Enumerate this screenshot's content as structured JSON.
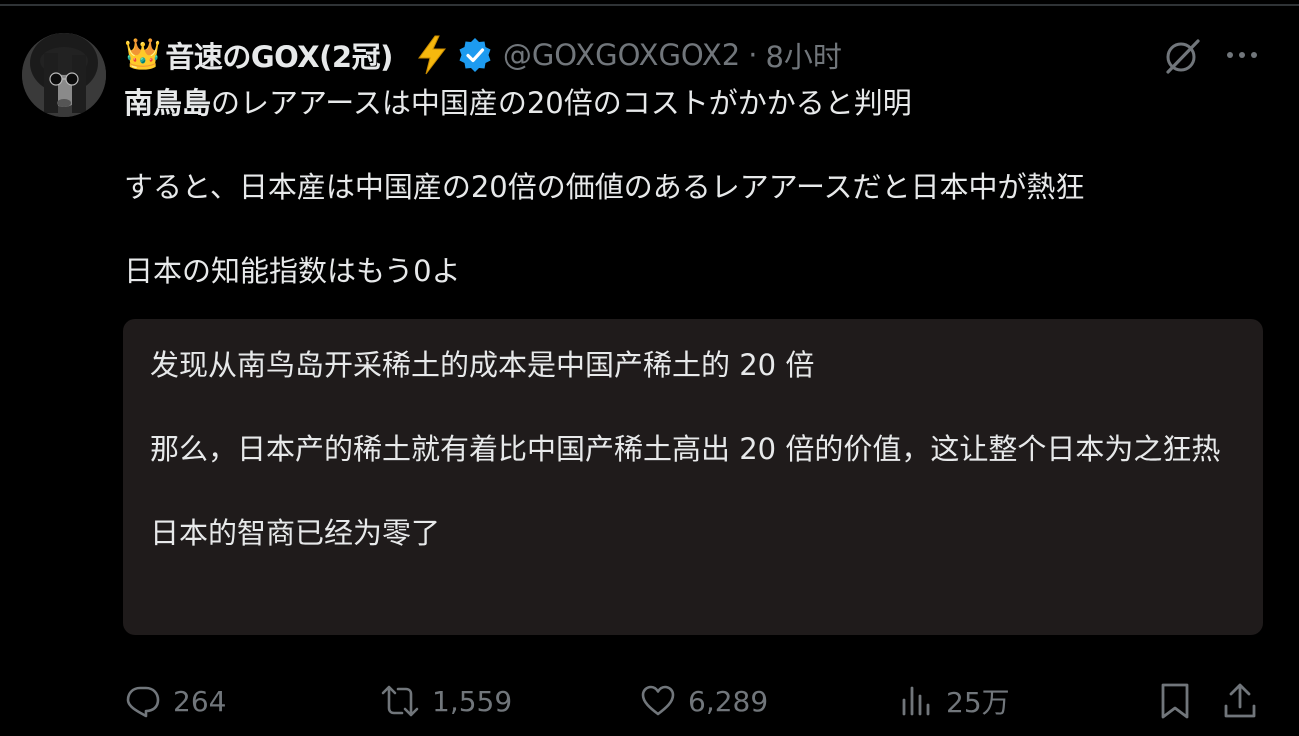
{
  "tweet": {
    "author": {
      "crown_emoji": "👑",
      "display_name": "音速のGOX(2冠)",
      "badge_emoji": "⚡",
      "handle": "@GOXGOXGOX2",
      "separator": "·",
      "time": "8小时"
    },
    "body": {
      "line1_bold": "南鳥島",
      "line1_rest": "のレアアースは中国産の20倍のコストがかかると判明",
      "line2": "すると、日本産は中国産の20倍の価値のあるレアアースだと日本中が熱狂",
      "line3": "日本の知能指数はもう0よ"
    },
    "translation": {
      "para1": "发现从南鸟岛开采稀土的成本是中国产稀土的 20 倍",
      "para2": "那么，日本产的稀土就有着比中国产稀土高出 20 倍的价值，这让整个日本为之狂热",
      "para3": "日本的智商已经为零了"
    },
    "actions": {
      "reply_count": "264",
      "retweet_count": "1,559",
      "like_count": "6,289",
      "view_count": "25万"
    }
  },
  "colors": {
    "background": "#000000",
    "text": "#e7e9ea",
    "muted": "#71767b",
    "verified_blue": "#1d9bf0",
    "translation_box": "#1f1b1b"
  }
}
